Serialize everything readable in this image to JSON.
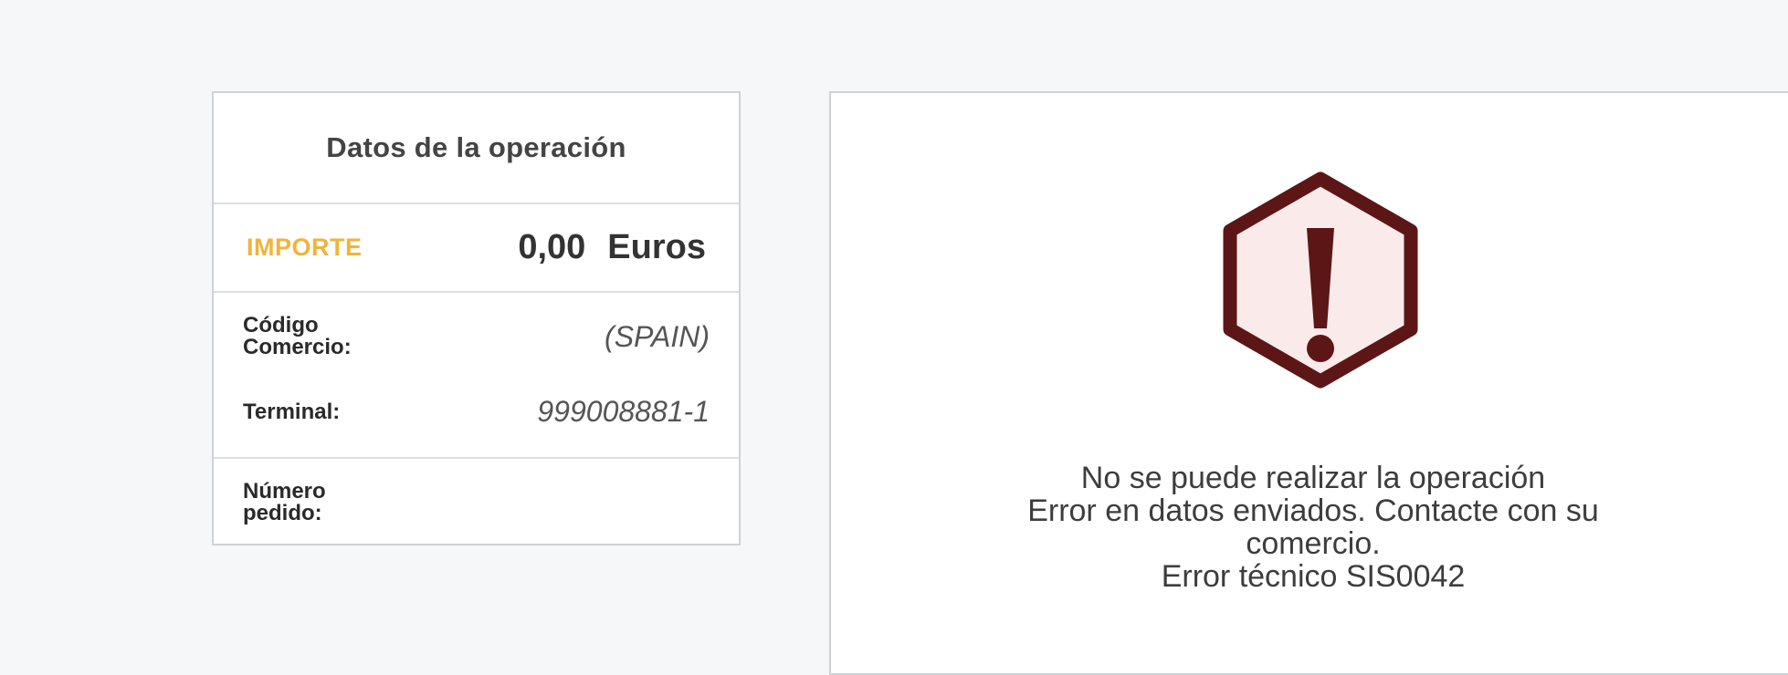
{
  "operation": {
    "title": "Datos de la operación",
    "amount_label": "IMPORTE",
    "amount_value": "0,00",
    "amount_currency": "Euros",
    "merchant_code_label": "Código Comercio:",
    "merchant_code_value": "(SPAIN)",
    "terminal_label": "Terminal:",
    "terminal_value": "999008881-1",
    "order_number_label": "Número pedido:"
  },
  "message": {
    "icon": "warning-hexagon-icon",
    "icon_color": "#5c1616",
    "icon_fill": "#fbeaea",
    "line1": "No se puede realizar la operación",
    "line2": "Error en datos enviados. Contacte con su comercio.",
    "line3": "Error técnico SIS0042"
  },
  "colors": {
    "accent": "#f0b43a",
    "background": "#f6f7f9"
  }
}
